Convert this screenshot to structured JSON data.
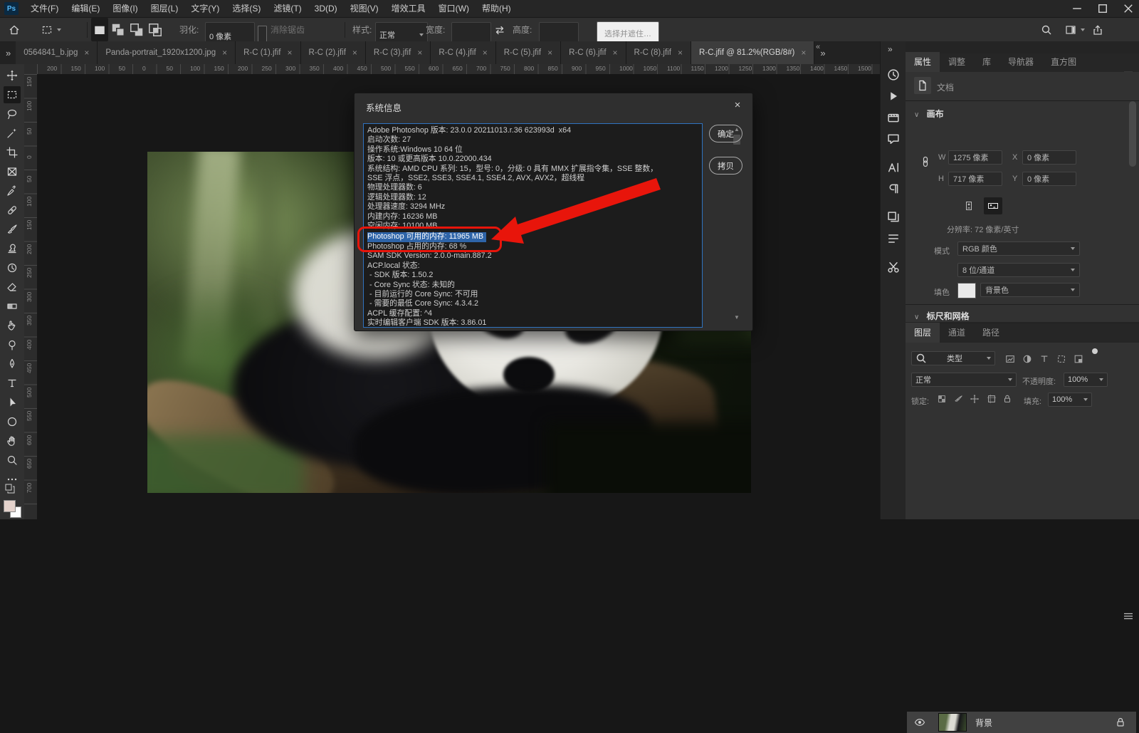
{
  "app": {
    "logo_text": "Ps"
  },
  "menu": {
    "items": [
      "文件(F)",
      "编辑(E)",
      "图像(I)",
      "图层(L)",
      "文字(Y)",
      "选择(S)",
      "滤镜(T)",
      "3D(D)",
      "视图(V)",
      "增效工具",
      "窗口(W)",
      "帮助(H)"
    ]
  },
  "options_bar": {
    "feather_label": "羽化:",
    "feather_value": "0 像素",
    "anti_alias_label": "消除锯齿",
    "style_label": "样式:",
    "style_value": "正常",
    "width_label": "宽度:",
    "width_value": "",
    "height_label": "高度:",
    "height_value": "",
    "select_and_mask_label": "选择并遮住…"
  },
  "document_tabs": {
    "overflow_left_glyph": "»",
    "overflow_right_glyph": "»",
    "close_glyph": "×",
    "tabs": [
      {
        "label": "0564841_b.jpg",
        "active": false
      },
      {
        "label": "Panda-portrait_1920x1200.jpg",
        "active": false
      },
      {
        "label": "R-C (1).jfif",
        "active": false
      },
      {
        "label": "R-C (2).jfif",
        "active": false
      },
      {
        "label": "R-C (3).jfif",
        "active": false
      },
      {
        "label": "R-C (4).jfif",
        "active": false
      },
      {
        "label": "R-C (5).jfif",
        "active": false
      },
      {
        "label": "R-C (6).jfif",
        "active": false
      },
      {
        "label": "R-C (8).jfif",
        "active": false
      },
      {
        "label": "R-C.jfif @ 81.2%(RGB/8#)",
        "active": true
      }
    ]
  },
  "toolbar": {
    "tools": [
      {
        "name": "move-tool",
        "active": false
      },
      {
        "name": "rect-marquee-tool",
        "active": true
      },
      {
        "name": "lasso-tool",
        "active": false
      },
      {
        "name": "object-selection-tool",
        "active": false
      },
      {
        "name": "crop-tool",
        "active": false
      },
      {
        "name": "frame-tool",
        "active": false
      },
      {
        "name": "eyedropper-tool",
        "active": false
      },
      {
        "name": "spot-healing-tool",
        "active": false
      },
      {
        "name": "brush-tool",
        "active": false
      },
      {
        "name": "clone-stamp-tool",
        "active": false
      },
      {
        "name": "history-brush-tool",
        "active": false
      },
      {
        "name": "eraser-tool",
        "active": false
      },
      {
        "name": "gradient-tool",
        "active": false
      },
      {
        "name": "smudge-tool",
        "active": false
      },
      {
        "name": "dodge-tool",
        "active": false
      },
      {
        "name": "pen-tool",
        "active": false
      },
      {
        "name": "type-tool",
        "active": false
      },
      {
        "name": "path-select-tool",
        "active": false
      },
      {
        "name": "shape-tool",
        "active": false
      },
      {
        "name": "hand-tool",
        "active": false
      },
      {
        "name": "zoom-tool",
        "active": false
      },
      {
        "name": "edit-toolbar",
        "active": false
      }
    ]
  },
  "rulers": {
    "horizontal_labels": [
      "200",
      "150",
      "100",
      "50",
      "0",
      "50",
      "100",
      "150",
      "200",
      "250",
      "300",
      "350",
      "400",
      "450",
      "500",
      "550",
      "600",
      "650",
      "700",
      "750",
      "800",
      "850",
      "900",
      "950",
      "1000",
      "1050",
      "1100",
      "1150",
      "1200",
      "1250",
      "1300",
      "1350",
      "1400",
      "1450",
      "1500"
    ],
    "vertical_labels": [
      "150",
      "100",
      "50",
      "0",
      "50",
      "100",
      "150",
      "200",
      "250",
      "300",
      "350",
      "400",
      "450",
      "500",
      "550",
      "600",
      "650",
      "700"
    ]
  },
  "dialog": {
    "title": "系统信息",
    "close_glyph": "×",
    "ok_label": "确定",
    "copy_label": "拷贝",
    "scroll_up_glyph": "▲",
    "scroll_down_glyph": "▼",
    "highlight_index": 11,
    "lines": [
      "Adobe Photoshop 版本: 23.0.0 20211013.r.36 623993d  x64",
      "启动次数: 27",
      "操作系统:Windows 10 64 位",
      "版本: 10 或更高版本 10.0.22000.434",
      "系统结构: AMD CPU 系列: 15，型号: 0，分级: 0 具有 MMX 扩展指令集，SSE 整数，",
      "SSE 浮点，SSE2, SSE3, SSE4.1, SSE4.2, AVX, AVX2，超线程",
      "物理处理器数: 6",
      "逻辑处理器数: 12",
      "处理器速度: 3294 MHz",
      "内建内存: 16236 MB",
      "空闲内存: 10100 MB",
      "Photoshop 可用的内存: 11965 MB",
      "Photoshop 占用的内存: 68 %",
      "SAM SDK Version: 2.0.0-main.887.2",
      "ACP.local 状态:",
      " - SDK 版本: 1.50.2",
      " - Core Sync 状态: 未知的",
      " - 目前运行的 Core Sync: 不可用",
      " - 需要的最低 Core Sync: 4.3.4.2",
      "ACPL 缓存配置: ^4",
      "实时编辑客户端 SDK 版本: 3.86.01"
    ]
  },
  "annotations": {
    "red_color": "#e8150b",
    "selection_color": "#2e64a8"
  },
  "right_dock": {
    "expand_glyph": "»",
    "collapse_glyph": "«",
    "panel_icons": [
      "version-history",
      "actions",
      "media",
      "notes",
      "character",
      "paragraph",
      "layer-comps",
      "info",
      "tool-presets"
    ]
  },
  "properties_panel": {
    "tabs": [
      "属性",
      "调整",
      "库",
      "导航器",
      "直方图"
    ],
    "active_tab_index": 0,
    "section_caret": "∨",
    "doc_label": "文档",
    "canvas_section": {
      "title": "画布",
      "w_label": "W",
      "w_value": "1275 像素",
      "x_label": "X",
      "x_value": "0 像素",
      "h_label": "H",
      "h_value": "717 像素",
      "y_label": "Y",
      "y_value": "0 像素",
      "resolution_text": "分辨率: 72 像素/英寸",
      "mode_label": "模式",
      "mode_value": "RGB 颜色",
      "depth_value": "8 位/通道",
      "fill_label": "填色",
      "fill_value": "背景色"
    },
    "rulers_section_title": "标尺和网格"
  },
  "layers_panel": {
    "tabs": [
      "图层",
      "通道",
      "路径"
    ],
    "active_tab_index": 0,
    "filter_value": "类型",
    "blend_mode_value": "正常",
    "opacity_label": "不透明度:",
    "opacity_value": "100%",
    "lock_label": "锁定:",
    "fill_label": "填充:",
    "fill_value": "100%",
    "layers": [
      {
        "name": "背景",
        "visible": true,
        "locked": true,
        "selected": true
      }
    ]
  }
}
